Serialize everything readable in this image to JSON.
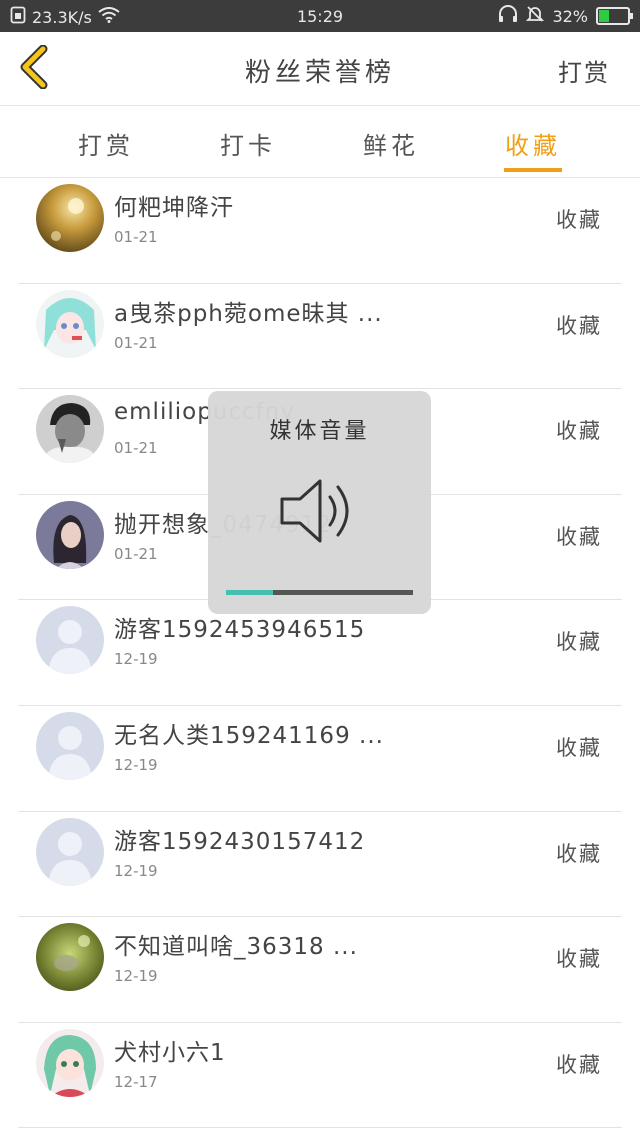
{
  "status_bar": {
    "network_speed": "23.3K/s",
    "time": "15:29",
    "battery_percent": "32%",
    "battery_level": 0.32,
    "icons": [
      "sim-icon",
      "wifi-icon",
      "headphones-icon",
      "mute-bell-icon",
      "battery-icon"
    ]
  },
  "header": {
    "title": "粉丝荣誉榜",
    "action_label": "打赏",
    "back_icon": "chevron-left-icon",
    "accent_color": "#f0a018"
  },
  "tabs": [
    {
      "label": "打赏",
      "active": false
    },
    {
      "label": "打卡",
      "active": false
    },
    {
      "label": "鲜花",
      "active": false
    },
    {
      "label": "收藏",
      "active": true
    }
  ],
  "list": [
    {
      "name": "何粑坤降汗",
      "date": "01-21",
      "action": "收藏",
      "avatar": "photo-sunset"
    },
    {
      "name": "a曳茶pph菀ome昧其 ...",
      "date": "01-21",
      "action": "收藏",
      "avatar": "anime-cyan"
    },
    {
      "name": "emliliopuccfny",
      "date": "01-21",
      "action": "收藏",
      "avatar": "photo-grey"
    },
    {
      "name": "抛开想象_0474912",
      "date": "01-21",
      "action": "收藏",
      "avatar": "photo-girl"
    },
    {
      "name": "游客1592453946515",
      "date": "12-19",
      "action": "收藏",
      "avatar": "default"
    },
    {
      "name": "无名人类159241169 ...",
      "date": "12-19",
      "action": "收藏",
      "avatar": "default"
    },
    {
      "name": "游客1592430157412",
      "date": "12-19",
      "action": "收藏",
      "avatar": "default"
    },
    {
      "name": "不知道叫啥_36318 ...",
      "date": "12-19",
      "action": "收藏",
      "avatar": "photo-green"
    },
    {
      "name": "犬村小六1",
      "date": "12-17",
      "action": "收藏",
      "avatar": "anime-girl"
    }
  ],
  "volume_overlay": {
    "title": "媒体音量",
    "icon": "speaker-icon",
    "level": 0.25,
    "fill_color": "#45c0b0"
  }
}
